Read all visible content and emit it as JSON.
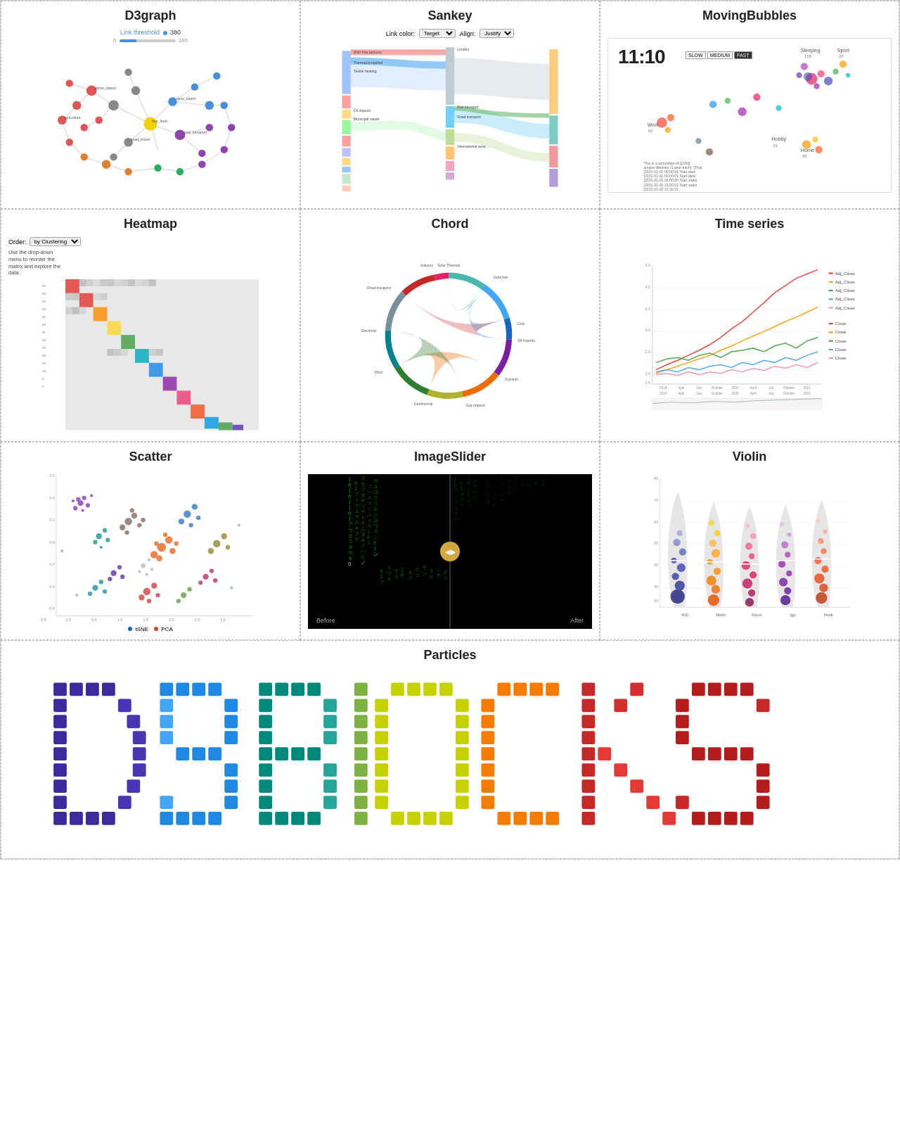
{
  "titles": {
    "d3graph": "D3graph",
    "sankey": "Sankey",
    "movingbubbles": "MovingBubbles",
    "heatmap": "Heatmap",
    "chord": "Chord",
    "timeseries": "Time series",
    "scatter": "Scatter",
    "imageslider": "ImageSlider",
    "violin": "Violin",
    "particles": "Particles"
  },
  "d3graph": {
    "link_threshold_label": "Link threshold",
    "link_threshold_value": "380",
    "slider_min": "0",
    "slider_max": "380"
  },
  "sankey": {
    "link_color_label": "Link color:",
    "link_color_value": "Target",
    "align_label": "Align:",
    "align_value": "Justify"
  },
  "heatmap": {
    "order_label": "Order:",
    "order_value": "by Clustering",
    "note": "Use the drop-down menu to reorder the matrix and explore the data."
  },
  "scatter": {
    "legend_tsne": "tSNE",
    "legend_pca": "PCA"
  },
  "imageslider": {
    "before_label": "Before",
    "after_label": "After"
  },
  "movingbubbles": {
    "timer": "11:10",
    "speed_slow": "SLOW",
    "speed_medium": "MEDIUM",
    "speed_fast": "FAST"
  },
  "timeseries": {
    "legend": [
      "Adj_Close",
      "Adj_Close",
      "Adj_Close",
      "Adj_Close",
      "Adj_Close",
      "Close",
      "Close",
      "Close",
      "Close",
      "Close"
    ]
  }
}
